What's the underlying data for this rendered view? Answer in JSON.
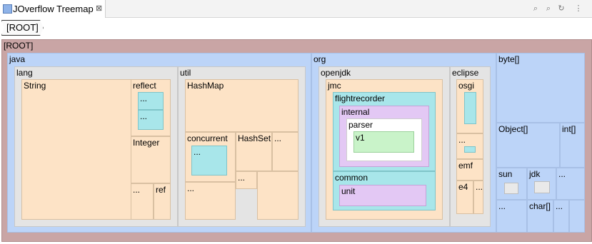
{
  "tab": {
    "title": "JOverflow Treemap",
    "close": "⊠"
  },
  "toolbar": {
    "icons": [
      "zoom-in-icon",
      "zoom-out-icon",
      "refresh-icon",
      "menu-icon"
    ]
  },
  "breadcrumb": {
    "root": "[ROOT]"
  },
  "treemap": {
    "root": "[ROOT]",
    "java": "java",
    "lang": "lang",
    "string": "String",
    "reflect": "reflect",
    "ellipsis": "...",
    "integer": "Integer",
    "ref": "ref",
    "util": "util",
    "hashmap": "HashMap",
    "concurrent": "concurrent",
    "hashset": "HashSet",
    "org": "org",
    "openjdk": "openjdk",
    "jmc": "jmc",
    "flightrecorder": "flightrecorder",
    "internal": "internal",
    "parser": "parser",
    "v1": "v1",
    "common": "common",
    "unit": "unit",
    "eclipse": "eclipse",
    "osgi": "osgi",
    "emf": "emf",
    "e4": "e4",
    "byte_arr": "byte[]",
    "object_arr": "Object[]",
    "int_arr": "int[]",
    "sun": "sun",
    "jdk": "jdk",
    "char_arr": "char[]"
  }
}
